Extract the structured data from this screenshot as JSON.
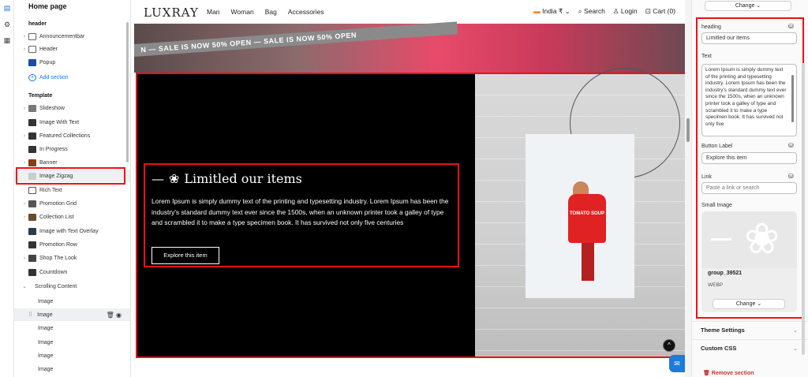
{
  "sidebar": {
    "title": "Home page",
    "header_section": "header",
    "header_items": [
      "Announcementbar",
      "Header",
      "Popup"
    ],
    "add_section": "Add section",
    "template_section": "Template",
    "template_items": [
      "Slideshow",
      "Image With Text",
      "Featured Collections",
      "In Progress",
      "Banner",
      "Image Zigzag",
      "Rich Text",
      "Promotion Grid",
      "Collection List",
      "Image with Text Overlay",
      "Promotion Row",
      "Shop The Look",
      "Countdown",
      "Scrolling Content"
    ],
    "scrolling_children": [
      "Image",
      "Image",
      "Image",
      "Image",
      "Image",
      "Image"
    ]
  },
  "preview": {
    "logo": "LUXRAY",
    "nav_links": [
      "Man",
      "Woman",
      "Bag",
      "Accessories"
    ],
    "india_label": "India ₹ ⌄",
    "search_label": "Search",
    "login_label": "Login",
    "cart_label": "Cart (0)",
    "banner_text": "N —   SALE IS NOW 50% OPEN   —   SALE IS NOW 50% OPEN",
    "zigzag": {
      "heading": "Limitled our items",
      "body": "Lorem Ipsum is simply dummy text of the printing and typesetting industry. Lorem Ipsum has been the industry's standard dummy text ever since the 1500s, when an unknown printer took a galley of type and scrambled it to make a type specimen book. It has survived not only five centuries",
      "button": "Explore this item",
      "sweater_text": "TOMATO SOUP"
    }
  },
  "panel": {
    "change_top": "Change ⌄",
    "heading_label": "heading",
    "heading_value": "Limitled our items",
    "text_label": "Text",
    "text_value": "Lorem Ipsum is simply dummy text of the printing and typesetting industry. Lorem Ipsum has been the industry's standard dummy text ever since the 1500s, when an unknown printer took a galley of type and scrambled it to make a type specimen book. It has survived not only five",
    "button_label_label": "Button Label",
    "button_label_value": "Explore this item",
    "link_label": "Link",
    "link_placeholder": "Paste a link or search",
    "small_image_label": "Small Image",
    "image_name": "group_39521",
    "image_type": "WEBP",
    "change_bottom": "Change ⌄",
    "theme_settings": "Theme Settings",
    "custom_css": "Custom CSS",
    "remove_section": "Remove section"
  }
}
